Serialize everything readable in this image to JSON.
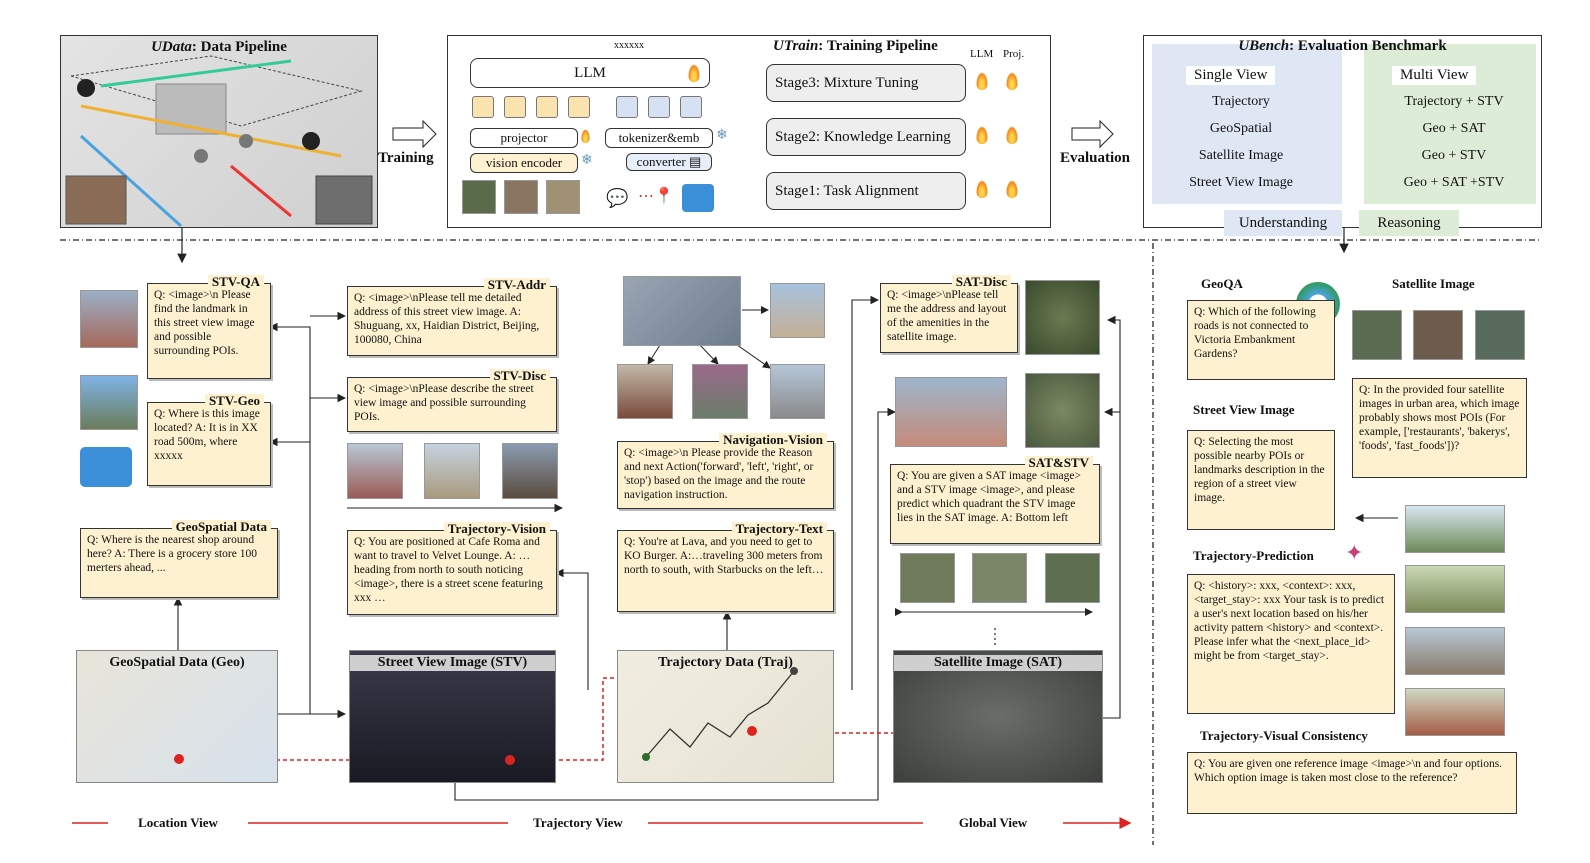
{
  "udata": {
    "title_em": "UData",
    "title_rest": ": Data Pipeline"
  },
  "training_label": "Training",
  "evaluation_label": "Evaluation",
  "utrain": {
    "title_em": "UTrain",
    "title_rest": ": Training Pipeline",
    "llm": "LLM",
    "llm_col": "LLM",
    "proj_col": "Proj.",
    "xxx": "xxxxxx",
    "projector": "projector",
    "vision_encoder": "vision encoder",
    "tokenizer": "tokenizer&emb",
    "converter": "converter",
    "stage3": "Stage3: Mixture Tuning",
    "stage2": "Stage2: Knowledge Learning",
    "stage1": "Stage1: Task Alignment"
  },
  "ubench": {
    "title_em": "UBench",
    "title_rest": ": Evaluation Benchmark",
    "single_view": "Single View",
    "multi_view": "Multi View",
    "single": [
      "Trajectory",
      "GeoSpatial",
      "Satellite Image",
      "Street View Image"
    ],
    "multi": [
      "Trajectory + STV",
      "Geo + SAT",
      "Geo + STV",
      "Geo + SAT +STV"
    ],
    "understanding": "Understanding",
    "reasoning": "Reasoning"
  },
  "tasks": {
    "stv_qa": {
      "title": "STV-QA",
      "text": "Q: <image>\\n Please find the landmark in this street view image and possible surrounding POIs."
    },
    "stv_geo": {
      "title": "STV-Geo",
      "text": "Q: Where is this image located? A:  It is in XX road 500m, where xxxxx"
    },
    "geo_data": {
      "title": "GeoSpatial Data",
      "text": "Q: Where is the nearest shop around here? A:  There is a grocery store 100 merters ahead, ..."
    },
    "stv_addr": {
      "title": "STV-Addr",
      "text": "Q: <image>\\nPlease tell me detailed address of this street view image. A: Shuguang, xx,  Haidian District, Beijing, 100080, China"
    },
    "stv_disc": {
      "title": "STV-Disc",
      "text": "Q: <image>\\nPlease describe the street view image and possible surrounding POIs."
    },
    "traj_vision": {
      "title": "Trajectory-Vision",
      "text": "Q: You are positioned at Cafe Roma  and want to travel to Velvet Lounge. A: …heading from north to south noticing <image>, there is a street scene featuring xxx …"
    },
    "nav_vision": {
      "title": "Navigation-Vision",
      "text": "Q: <image>\\n Please provide the Reason and next Action('forward', 'left', 'right', or 'stop') based on the image and the route navigation instruction."
    },
    "traj_text": {
      "title": "Trajectory-Text",
      "text": "Q: You're at Lava, and you need to get to KO Burger. A:…traveling 300 meters from north to south, with Starbucks on the left…"
    },
    "sat_disc": {
      "title": "SAT-Disc",
      "text": "Q: <image>\\nPlease tell me the address and layout of the amenities in the satellite image."
    },
    "sat_stv": {
      "title": "SAT&STV",
      "text": "Q: You are given a SAT image <image> and a STV image <image>, and please predict which quadrant the STV image lies in the SAT image. A: Bottom left"
    }
  },
  "data_sources": {
    "geo": "GeoSpatial Data (Geo)",
    "stv": "Street View Image (STV)",
    "traj": "Trajectory Data (Traj)",
    "sat": "Satellite Image (SAT)"
  },
  "views": {
    "location": "Location View",
    "trajectory": "Trajectory View",
    "global": "Global View"
  },
  "right_understanding": {
    "geoqa": {
      "title": "GeoQA",
      "text": "Q: Which of the following roads is not connected to Victoria Embankment Gardens?"
    },
    "sat": {
      "title": "Satellite Image",
      "text": "Q: In the provided four satellite images in urban area, which image probably shows most POIs (For example, ['restaurants', 'bakerys', 'foods', 'fast_foods'])?"
    },
    "stv": {
      "title": "Street View Image",
      "text": "Q: Selecting the most possible nearby POIs or landmarks description in the region of a street view image."
    }
  },
  "right_reasoning": {
    "traj_pred": {
      "title": "Trajectory-Prediction",
      "text": "Q: <history>: xxx, <context>: xxx, <target_stay>: xxx Your task is to predict a user's next location based on his/her activity pattern <history> and <context>. Please infer what the <next_place_id> might be from <target_stay>."
    },
    "traj_vis": {
      "title": "Trajectory-Visual Consistency",
      "text": "Q: You are given one reference image <image>\\n and four options. Which option image is taken most close to the reference?"
    }
  }
}
